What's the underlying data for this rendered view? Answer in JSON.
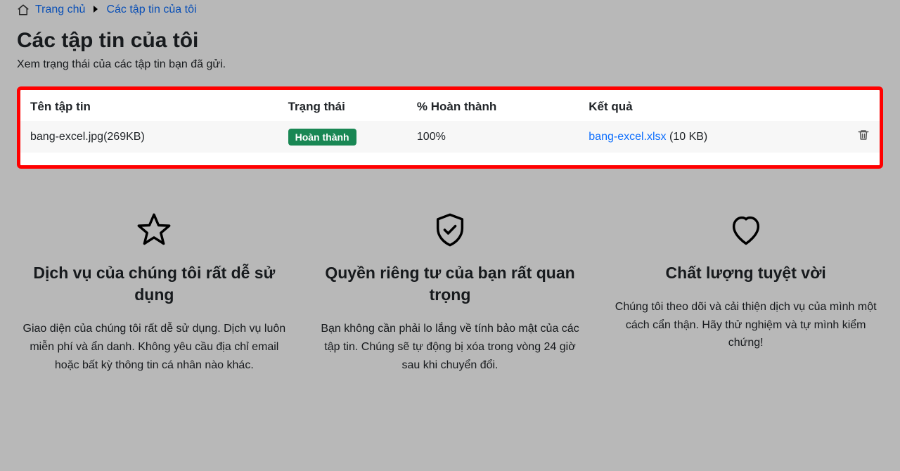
{
  "breadcrumb": {
    "home": "Trang chủ",
    "current": "Các tập tin của tôi"
  },
  "page": {
    "title": "Các tập tin của tôi",
    "subtitle": "Xem trạng thái của các tập tin bạn đã gửi."
  },
  "table": {
    "headers": {
      "filename": "Tên tập tin",
      "status": "Trạng thái",
      "percent": "% Hoàn thành",
      "result": "Kết quả"
    },
    "rows": [
      {
        "filename": "bang-excel.jpg(269KB)",
        "status_badge": "Hoàn thành",
        "percent": "100%",
        "result_link": "bang-excel.xlsx",
        "result_size": " (10 KB)"
      }
    ]
  },
  "features": [
    {
      "title": "Dịch vụ của chúng tôi rất dễ sử dụng",
      "body": "Giao diện của chúng tôi rất dễ sử dụng. Dịch vụ luôn miễn phí và ẩn danh. Không yêu cầu địa chỉ email hoặc bất kỳ thông tin cá nhân nào khác."
    },
    {
      "title": "Quyền riêng tư của bạn rất quan trọng",
      "body": "Bạn không cần phải lo lắng về tính bảo mật của các tập tin. Chúng sẽ tự động bị xóa trong vòng 24 giờ sau khi chuyển đổi."
    },
    {
      "title": "Chất lượng tuyệt vời",
      "body": "Chúng tôi theo dõi và cải thiện dịch vụ của mình một cách cẩn thận. Hãy thử nghiệm và tự mình kiểm chứng!"
    }
  ]
}
